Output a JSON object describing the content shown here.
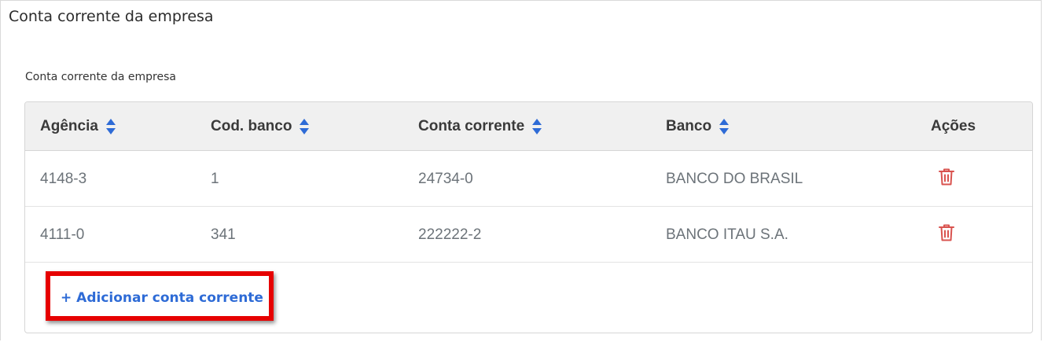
{
  "panel": {
    "title": "Conta corrente da empresa",
    "section_label": "Conta corrente da empresa"
  },
  "table": {
    "headers": {
      "agencia": "Agência",
      "cod_banco": "Cod. banco",
      "conta_corrente": "Conta corrente",
      "banco": "Banco",
      "acoes": "Ações"
    },
    "rows": [
      {
        "agencia": "4148-3",
        "cod_banco": "1",
        "conta_corrente": "24734-0",
        "banco": "BANCO DO BRASIL"
      },
      {
        "agencia": "4111-0",
        "cod_banco": "341",
        "conta_corrente": "222222-2",
        "banco": "BANCO ITAU S.A."
      }
    ]
  },
  "actions": {
    "add_label": "+ Adicionar conta corrente"
  },
  "icons": {
    "sort": "sort-icon",
    "delete": "trash-icon"
  },
  "colors": {
    "link": "#2e6bd6",
    "sort_icon": "#2e6bd6",
    "delete_icon": "#d9534f",
    "highlight": "#e60000"
  }
}
